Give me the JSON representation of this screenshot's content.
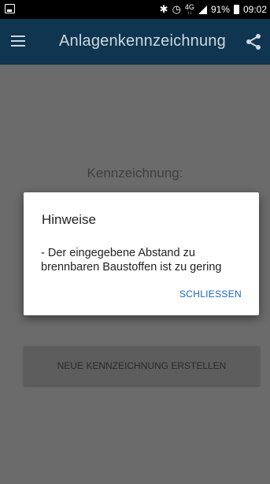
{
  "status_bar": {
    "network": "4G",
    "network_sub": "↑↓",
    "battery": "91%",
    "time": "09:02",
    "icons": [
      "image-icon",
      "bluetooth-icon",
      "alarm-icon",
      "signal-icon",
      "battery-icon"
    ]
  },
  "app_bar": {
    "title": "Anlagenkennzeichnung",
    "menu_icon": "hamburger-menu-icon",
    "share_icon": "share-icon"
  },
  "main": {
    "label": "Kennzeichnung:",
    "create_button": "NEUE KENNZEICHNUNG ERSTELLEN"
  },
  "dialog": {
    "title": "Hinweise",
    "message": " - Der eingegebene Abstand zu brennbaren Baustoffen ist zu gering",
    "close_button": "SCHLIESSEN"
  },
  "colors": {
    "app_bar": "#0f3550",
    "background_dimmed": "#6b6b6b",
    "accent": "#1565c0"
  }
}
